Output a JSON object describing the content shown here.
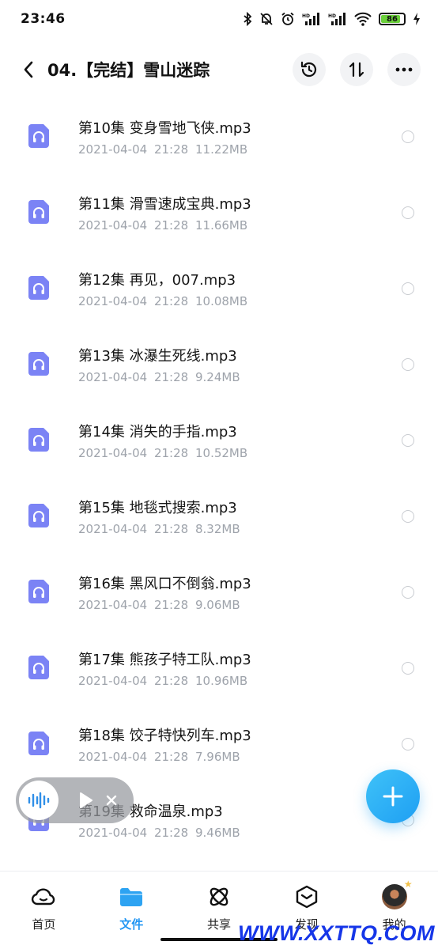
{
  "status_bar": {
    "time": "23:46",
    "battery": "86",
    "battery_level": 0.86
  },
  "header": {
    "title": "04.【完结】雪山迷踪"
  },
  "files": [
    {
      "name": "第10集 变身雪地飞侠.mp3",
      "date": "2021-04-04",
      "time": "21:28",
      "size": "11.22MB"
    },
    {
      "name": "第11集 滑雪速成宝典.mp3",
      "date": "2021-04-04",
      "time": "21:28",
      "size": "11.66MB"
    },
    {
      "name": "第12集 再见，007.mp3",
      "date": "2021-04-04",
      "time": "21:28",
      "size": "10.08MB"
    },
    {
      "name": "第13集 冰瀑生死线.mp3",
      "date": "2021-04-04",
      "time": "21:28",
      "size": "9.24MB"
    },
    {
      "name": "第14集 消失的手指.mp3",
      "date": "2021-04-04",
      "time": "21:28",
      "size": "10.52MB"
    },
    {
      "name": "第15集 地毯式搜索.mp3",
      "date": "2021-04-04",
      "time": "21:28",
      "size": "8.32MB"
    },
    {
      "name": "第16集 黑风口不倒翁.mp3",
      "date": "2021-04-04",
      "time": "21:28",
      "size": "9.06MB"
    },
    {
      "name": "第17集 熊孩子特工队.mp3",
      "date": "2021-04-04",
      "time": "21:28",
      "size": "10.96MB"
    },
    {
      "name": "第18集 饺子特快列车.mp3",
      "date": "2021-04-04",
      "time": "21:28",
      "size": "7.96MB"
    },
    {
      "name": "第19集 救命温泉.mp3",
      "date": "2021-04-04",
      "time": "21:28",
      "size": "9.46MB"
    }
  ],
  "nav": [
    {
      "label": "首页",
      "icon": "cloud-icon",
      "active": false
    },
    {
      "label": "文件",
      "icon": "folder-icon",
      "active": true
    },
    {
      "label": "共享",
      "icon": "atom-icon",
      "active": false
    },
    {
      "label": "发现",
      "icon": "cube-icon",
      "active": false
    },
    {
      "label": "我的",
      "icon": "avatar",
      "active": false
    }
  ],
  "watermark": "WWW.XXTTQ.COM",
  "colors": {
    "accent": "#2196f3",
    "file_icon": "#7b83f5",
    "fab": "#28aef5"
  }
}
